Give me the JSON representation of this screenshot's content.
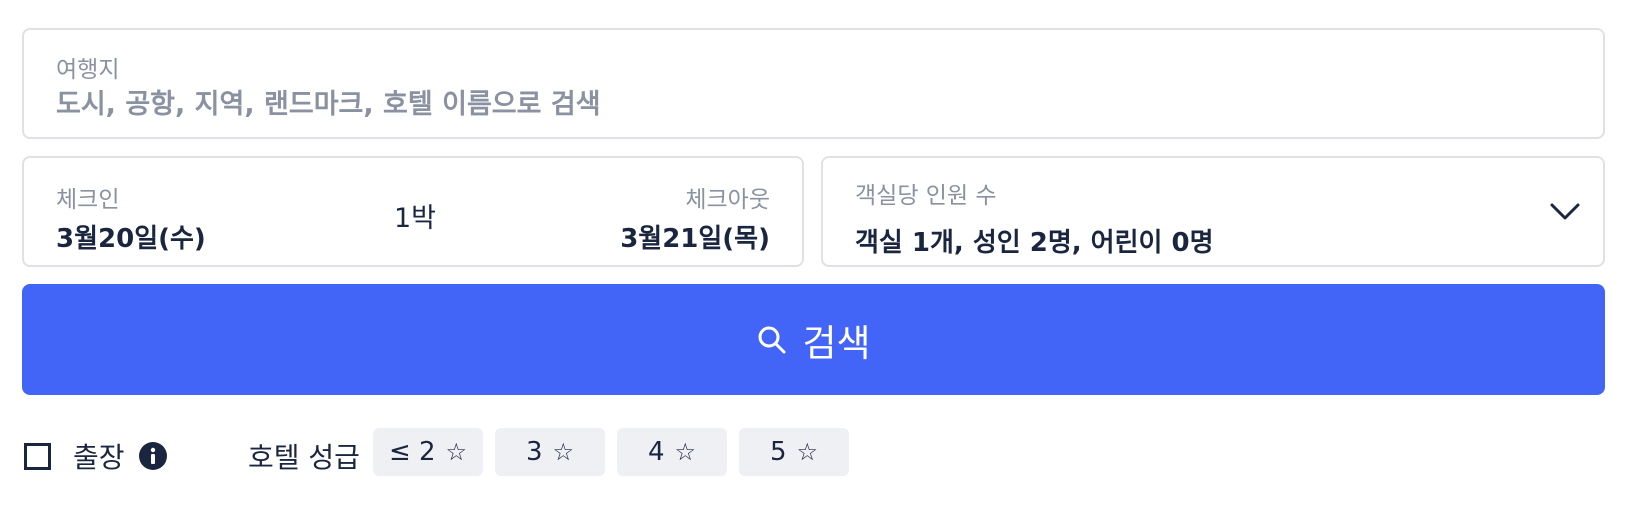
{
  "destination": {
    "label": "여행지",
    "placeholder": "도시, 공항, 지역, 랜드마크, 호텔 이름으로 검색",
    "value": ""
  },
  "dates": {
    "checkin_label": "체크인",
    "checkin_value": "3월20일(수)",
    "nights": "1박",
    "checkout_label": "체크아웃",
    "checkout_value": "3월21일(목)"
  },
  "guests": {
    "label": "객실당 인원 수",
    "value": "객실 1개, 성인 2명, 어린이 0명",
    "icon": "chevron-down-icon"
  },
  "search_button": {
    "label": "검색",
    "icon": "search-icon",
    "color": "#4265f8"
  },
  "business_trip": {
    "label": "출장",
    "checked": false,
    "icon": "info-icon"
  },
  "star_rating": {
    "label": "호텔 성급",
    "star_icon": "☆",
    "options": [
      "≤ 2",
      "3",
      "4",
      "5"
    ]
  }
}
